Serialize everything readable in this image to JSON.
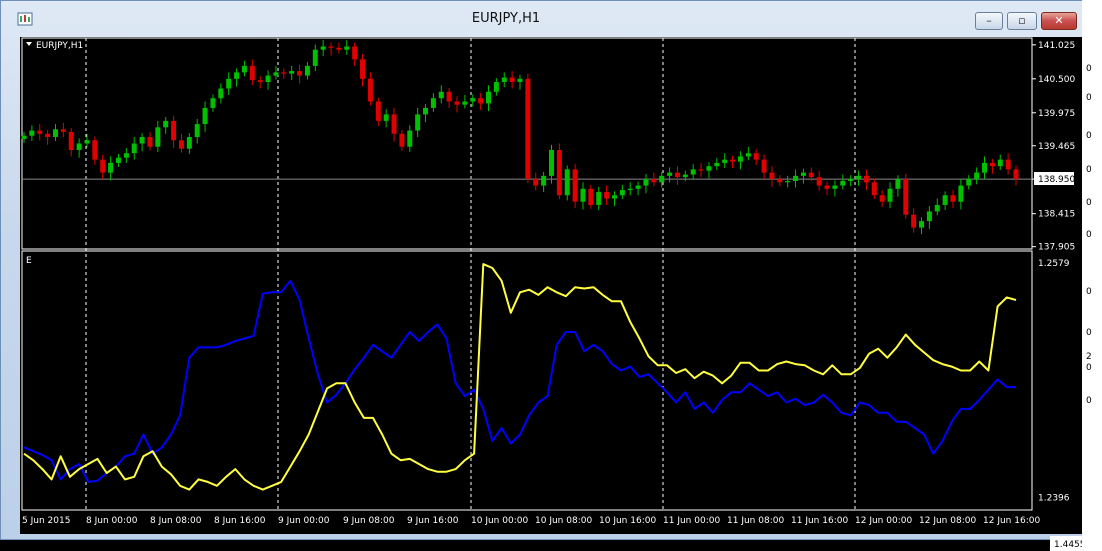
{
  "window": {
    "title": "EURJPY,H1"
  },
  "titlebar_buttons": {
    "minimize": "–",
    "maximize": "▫",
    "close": "✕"
  },
  "price_panel": {
    "label": "EURJPY,H1",
    "current_price": "138.950"
  },
  "indicator_panel": {
    "label": "E"
  },
  "bottom_right_label": "1.4455",
  "edge_labels": [
    "0",
    "0",
    "0",
    "0",
    "0",
    "0",
    "0",
    "0",
    "2",
    "0",
    "0"
  ],
  "colors": {
    "bull": "#00c000",
    "bear": "#e00000",
    "series_blue": "#0000ff",
    "series_yellow": "#ffff40",
    "frame": "#ffffff"
  },
  "chart_data": [
    {
      "type": "candlestick",
      "symbol": "EURJPY",
      "timeframe": "H1",
      "y_ticks": [
        "141.025",
        "140.500",
        "139.975",
        "139.465",
        "138.950",
        "138.415",
        "137.905"
      ],
      "ylim": [
        137.9,
        141.1
      ],
      "x_labels": [
        "5 Jun 2015",
        "8 Jun 00:00",
        "8 Jun 08:00",
        "8 Jun 16:00",
        "9 Jun 00:00",
        "9 Jun 08:00",
        "9 Jun 16:00",
        "10 Jun 00:00",
        "10 Jun 08:00",
        "10 Jun 16:00",
        "11 Jun 00:00",
        "11 Jun 08:00",
        "11 Jun 16:00",
        "12 Jun 00:00",
        "12 Jun 08:00",
        "12 Jun 16:00"
      ],
      "close": [
        139.62,
        139.7,
        139.65,
        139.6,
        139.72,
        139.68,
        139.4,
        139.5,
        139.55,
        139.25,
        139.05,
        139.2,
        139.28,
        139.35,
        139.5,
        139.6,
        139.45,
        139.75,
        139.85,
        139.55,
        139.42,
        139.6,
        139.8,
        140.05,
        140.2,
        140.35,
        140.5,
        140.6,
        140.7,
        140.48,
        140.45,
        140.55,
        140.6,
        140.58,
        140.62,
        140.55,
        140.7,
        140.95,
        141.0,
        140.98,
        140.95,
        141.0,
        140.8,
        140.5,
        140.15,
        139.85,
        139.95,
        139.65,
        139.45,
        139.7,
        139.95,
        140.05,
        140.2,
        140.3,
        140.15,
        140.1,
        140.15,
        140.2,
        140.12,
        140.3,
        140.45,
        140.52,
        140.45,
        140.5,
        138.95,
        138.85,
        139.0,
        139.4,
        138.7,
        139.1,
        138.6,
        138.8,
        138.55,
        138.75,
        138.65,
        138.7,
        138.78,
        138.8,
        138.85,
        138.95,
        138.9,
        139.0,
        139.05,
        138.98,
        139.02,
        139.1,
        139.08,
        139.15,
        139.2,
        139.25,
        139.22,
        139.3,
        139.35,
        139.25,
        139.05,
        138.95,
        138.9,
        138.92,
        139.0,
        139.05,
        138.98,
        138.85,
        138.8,
        138.85,
        138.92,
        138.95,
        139.0,
        138.9,
        138.7,
        138.6,
        138.8,
        138.95,
        138.4,
        138.2,
        138.3,
        138.45,
        138.55,
        138.7,
        138.6,
        138.85,
        138.95,
        139.05,
        139.2,
        139.15,
        139.25,
        139.1,
        138.95
      ]
    },
    {
      "type": "line",
      "x_labels": [
        "5 Jun 2015",
        "8 Jun 00:00",
        "8 Jun 08:00",
        "8 Jun 16:00",
        "9 Jun 00:00",
        "9 Jun 08:00",
        "9 Jun 16:00",
        "10 Jun 00:00",
        "10 Jun 08:00",
        "10 Jun 16:00",
        "11 Jun 00:00",
        "11 Jun 08:00",
        "11 Jun 16:00",
        "12 Jun 00:00",
        "12 Jun 08:00",
        "12 Jun 16:00"
      ],
      "y_ticks": [
        "1.2579",
        "1.2396"
      ],
      "ylim": [
        1.239,
        1.2582
      ],
      "series": [
        {
          "color": "blue",
          "values": [
            1.2435,
            1.2432,
            1.2429,
            1.2425,
            1.241,
            1.2418,
            1.2422,
            1.2408,
            1.2409,
            1.2415,
            1.242,
            1.2428,
            1.243,
            1.2445,
            1.243,
            1.2435,
            1.2445,
            1.246,
            1.2505,
            1.2513,
            1.2513,
            1.2513,
            1.2515,
            1.2518,
            1.252,
            1.2522,
            1.2555,
            1.2556,
            1.2556,
            1.2565,
            1.255,
            1.252,
            1.2492,
            1.247,
            1.2476,
            1.2485,
            1.2496,
            1.2505,
            1.2515,
            1.251,
            1.2505,
            1.2515,
            1.2525,
            1.2518,
            1.2525,
            1.2531,
            1.252,
            1.2485,
            1.2475,
            1.248,
            1.2465,
            1.244,
            1.245,
            1.2438,
            1.2445,
            1.246,
            1.247,
            1.2475,
            1.2515,
            1.2525,
            1.2525,
            1.251,
            1.2515,
            1.251,
            1.25,
            1.2495,
            1.2498,
            1.249,
            1.2492,
            1.2485,
            1.2478,
            1.247,
            1.2478,
            1.2465,
            1.247,
            1.2462,
            1.2472,
            1.2478,
            1.2478,
            1.2485,
            1.248,
            1.2475,
            1.2478,
            1.247,
            1.2473,
            1.2468,
            1.247,
            1.2476,
            1.247,
            1.2462,
            1.246,
            1.247,
            1.2468,
            1.2462,
            1.2462,
            1.2455,
            1.2455,
            1.245,
            1.2445,
            1.243,
            1.244,
            1.2455,
            1.2465,
            1.2465,
            1.2472,
            1.248,
            1.2488,
            1.2482,
            1.2482
          ]
        },
        {
          "color": "yellow",
          "values": [
            1.243,
            1.2425,
            1.2418,
            1.241,
            1.2428,
            1.2412,
            1.2418,
            1.2422,
            1.2426,
            1.2415,
            1.242,
            1.241,
            1.2412,
            1.2428,
            1.2432,
            1.242,
            1.2414,
            1.2405,
            1.2402,
            1.241,
            1.2408,
            1.2405,
            1.2412,
            1.2418,
            1.241,
            1.2405,
            1.2402,
            1.2405,
            1.2408,
            1.242,
            1.2432,
            1.2445,
            1.2463,
            1.2481,
            1.2485,
            1.2485,
            1.247,
            1.2458,
            1.2458,
            1.2445,
            1.243,
            1.2425,
            1.2426,
            1.2422,
            1.2418,
            1.2416,
            1.2416,
            1.2418,
            1.2425,
            1.243,
            1.2578,
            1.2575,
            1.2565,
            1.254,
            1.2556,
            1.2558,
            1.2554,
            1.256,
            1.2556,
            1.2553,
            1.256,
            1.2559,
            1.256,
            1.2554,
            1.2549,
            1.2549,
            1.2533,
            1.252,
            1.2506,
            1.2499,
            1.2499,
            1.2493,
            1.2496,
            1.2489,
            1.2494,
            1.2491,
            1.2485,
            1.2491,
            1.2501,
            1.2501,
            1.2495,
            1.2495,
            1.25,
            1.2502,
            1.25,
            1.2499,
            1.2495,
            1.2492,
            1.2499,
            1.2492,
            1.2492,
            1.2497,
            1.2508,
            1.2512,
            1.2505,
            1.2513,
            1.2523,
            1.2515,
            1.2509,
            1.2503,
            1.25,
            1.2498,
            1.2495,
            1.2495,
            1.2502,
            1.2495,
            1.2545,
            1.2552,
            1.255
          ]
        }
      ]
    }
  ]
}
